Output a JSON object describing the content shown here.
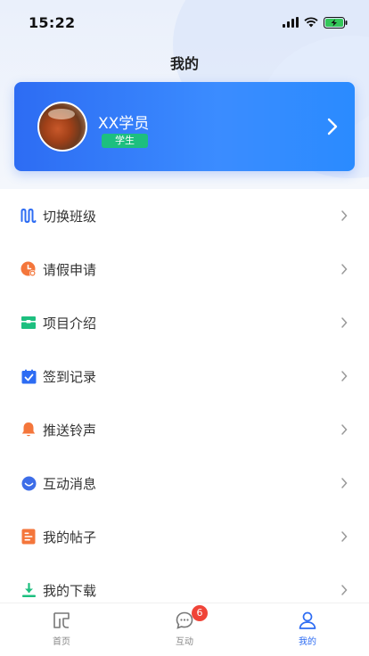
{
  "status_bar": {
    "time": "15:22"
  },
  "header": {
    "title": "我的"
  },
  "profile": {
    "name": "XX学员",
    "role": "学生"
  },
  "menu": {
    "items": [
      {
        "label": "切换班级",
        "icon": "switch-class-icon",
        "color": "#2d6cf3"
      },
      {
        "label": "请假申请",
        "icon": "leave-request-icon",
        "color": "#f4763b"
      },
      {
        "label": "项目介绍",
        "icon": "project-intro-icon",
        "color": "#1dbf7f"
      },
      {
        "label": "签到记录",
        "icon": "check-in-icon",
        "color": "#2d6cf3"
      },
      {
        "label": "推送铃声",
        "icon": "bell-icon",
        "color": "#f4763b"
      },
      {
        "label": "互动消息",
        "icon": "message-icon",
        "color": "#3d6de8"
      },
      {
        "label": "我的帖子",
        "icon": "posts-icon",
        "color": "#f4763b"
      },
      {
        "label": "我的下载",
        "icon": "download-icon",
        "color": "#1dbf7f"
      }
    ]
  },
  "tab_bar": {
    "home_label": "首页",
    "interact_label": "互动",
    "interact_badge": "6",
    "mine_label": "我的",
    "active_color": "#2d6cf3"
  }
}
